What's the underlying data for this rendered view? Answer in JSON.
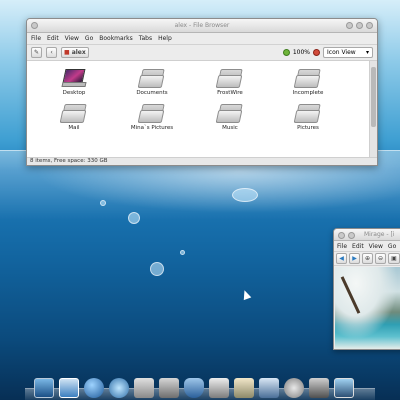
{
  "file_browser": {
    "title": "alex - File Browser",
    "menu": [
      "File",
      "Edit",
      "View",
      "Go",
      "Bookmarks",
      "Tabs",
      "Help"
    ],
    "location": "alex",
    "zoom": "100%",
    "view_mode": "Icon View",
    "items": [
      {
        "label": "Desktop",
        "icon": "desktop-icon"
      },
      {
        "label": "Documents",
        "icon": "folder-icon"
      },
      {
        "label": "FrostWire",
        "icon": "folder-icon"
      },
      {
        "label": "Incomplete",
        "icon": "folder-icon"
      },
      {
        "label": "Mail",
        "icon": "folder-icon"
      },
      {
        "label": "Mina`s Pictures",
        "icon": "folder-icon"
      },
      {
        "label": "Music",
        "icon": "folder-icon"
      },
      {
        "label": "Pictures",
        "icon": "folder-icon"
      }
    ],
    "status": "8 items, Free space: 330 GB"
  },
  "mirage": {
    "title": "Mirage - [i",
    "menu": [
      "File",
      "Edit",
      "View",
      "Go",
      "He"
    ]
  },
  "dock": {
    "icons": [
      "monitor-icon",
      "window-icon",
      "globe-icon",
      "gecko-icon",
      "tools-icon",
      "multimedia-icon",
      "shield-icon",
      "printer-icon",
      "picture-icon",
      "network-icon",
      "gear-icon",
      "hard-drive-icon",
      "photo-icon"
    ]
  }
}
